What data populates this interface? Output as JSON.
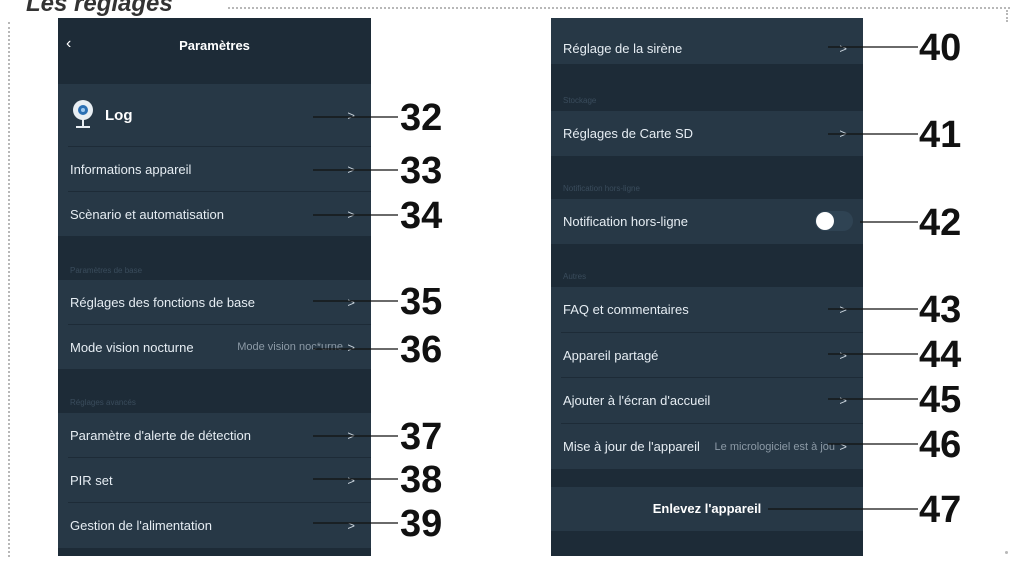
{
  "page_title": "Les réglages",
  "left": {
    "title": "Paramètres",
    "back_icon": "chevron-left-icon",
    "device_name": "Log",
    "device_icon": "camera-icon",
    "items": [
      {
        "label": "Informations appareil"
      },
      {
        "label": "Scènario et automatisation"
      }
    ],
    "section_basic": "Paramètres de base",
    "basic_items": [
      {
        "label": "Réglages des fonctions de base",
        "value": ""
      },
      {
        "label": "Mode vision nocturne",
        "value": "Mode vision noc*urne"
      }
    ],
    "section_advanced": "Réglages avancés",
    "advanced_items": [
      {
        "label": "Paramètre d'alerte de détection"
      },
      {
        "label": "PIR set"
      },
      {
        "label": "Gestion de l'alimentation"
      }
    ]
  },
  "right": {
    "siren": "Réglage de la sirène",
    "section_storage": "Stockage",
    "sd": "Réglages de Carte SD",
    "section_offline": "Notification hors-ligne",
    "offline_label": "Notification hors-ligne",
    "offline_enabled": false,
    "section_others": "Autres",
    "other_items": [
      {
        "label": "FAQ et commentaires",
        "value": ""
      },
      {
        "label": "Appareil partagé",
        "value": ""
      },
      {
        "label": "Ajouter à l'écran d'accueil",
        "value": ""
      },
      {
        "label": "Mise à jour de l'appareil",
        "value": "Le micrologiciel est à jou"
      }
    ],
    "remove": "Enlevez l'appareil"
  },
  "chevron": ">",
  "callouts": [
    "32",
    "33",
    "34",
    "35",
    "36",
    "37",
    "38",
    "39",
    "40",
    "41",
    "42",
    "43",
    "44",
    "45",
    "46",
    "47"
  ],
  "colors": {
    "screen_bg": "#1d2b37",
    "row_bg": "#273846",
    "text": "#e6edf3",
    "callout": "#111111"
  }
}
